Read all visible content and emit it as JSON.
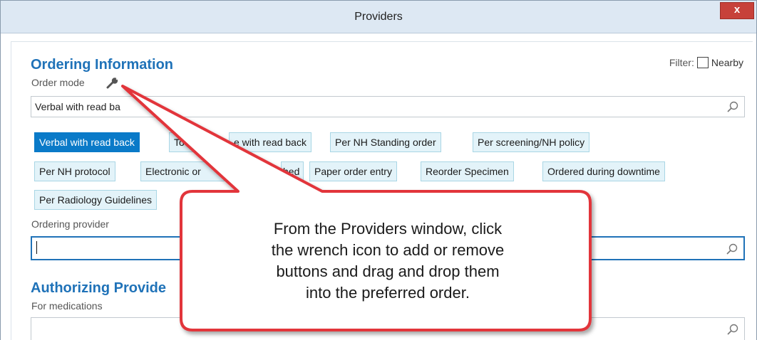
{
  "window": {
    "title": "Providers",
    "close_label": "x"
  },
  "ordering": {
    "section_title": "Ordering Information",
    "order_mode_label": "Order mode",
    "order_mode_value": "Verbal with read ba",
    "filter_label": "Filter:",
    "nearby_label": "Nearby",
    "buttons": [
      "Verbal with read back",
      "To",
      "e with read back",
      "Per NH Standing order",
      "Per screening/NH policy",
      "Per NH protocol",
      "Electronic or",
      "hed",
      "Paper order entry",
      "Reorder Specimen",
      "Ordered during downtime",
      "Per Radiology Guidelines"
    ],
    "ordering_provider_label": "Ordering provider",
    "ordering_provider_value": ""
  },
  "authorizing": {
    "section_title": "Authorizing Provide",
    "for_medications_label": "For medications",
    "value": ""
  },
  "callout": {
    "lines": [
      "From the Providers window, click",
      "the wrench icon to add or remove",
      "buttons and drag and drop them",
      "into the preferred order."
    ]
  },
  "colors": {
    "accent": "#1f72b8",
    "callout_border": "#e2343b",
    "selected_button": "#0a7ac8"
  }
}
